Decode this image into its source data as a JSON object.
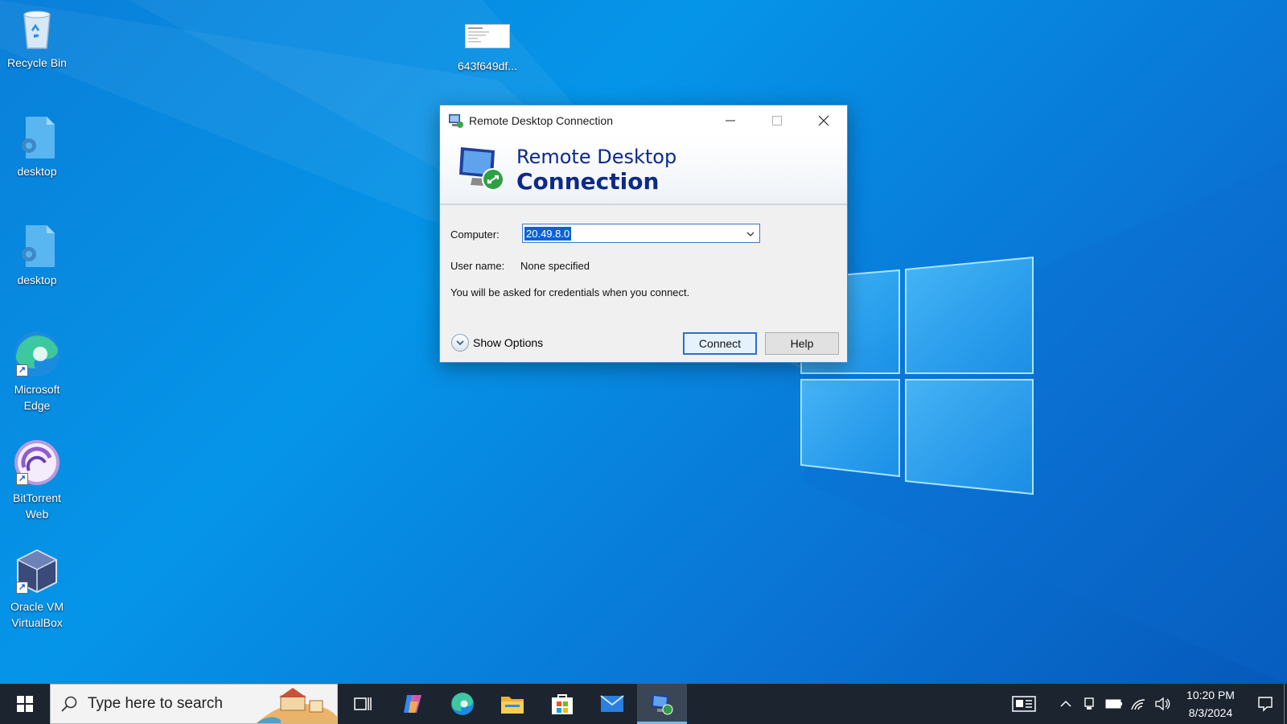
{
  "desktop": {
    "icons": [
      {
        "label": "Recycle Bin",
        "icon": "recycle-bin-icon"
      },
      {
        "label": "643f649df...",
        "icon": "image-thumbnail-icon"
      },
      {
        "label": "desktop",
        "icon": "settings-file-icon"
      },
      {
        "label": "desktop",
        "icon": "settings-file-icon"
      },
      {
        "label": "Microsoft Edge",
        "icon": "edge-icon"
      },
      {
        "label": "BitTorrent Web",
        "icon": "bittorrent-icon"
      },
      {
        "label": "Oracle VM VirtualBox",
        "icon": "virtualbox-icon"
      }
    ]
  },
  "rdp_dialog": {
    "title": "Remote Desktop Connection",
    "banner_line1": "Remote Desktop",
    "banner_line2": "Connection",
    "computer_label": "Computer:",
    "computer_value": "20.49.8.0",
    "username_label": "User name:",
    "username_value": "None specified",
    "info_text": "You will be asked for credentials when you connect.",
    "show_options_label": "Show Options",
    "connect_label": "Connect",
    "help_label": "Help"
  },
  "taskbar": {
    "search_placeholder": "Type here to search",
    "pinned": [
      "task-view-icon",
      "copilot-icon",
      "edge-icon",
      "file-explorer-icon",
      "microsoft-store-icon",
      "mail-icon",
      "remote-desktop-icon"
    ],
    "active_app": "remote-desktop-icon",
    "time": "10:20 PM",
    "date": "8/3/2024"
  },
  "colors": {
    "desktop_blue": "#0a7fd9",
    "taskbar_bg": "#1c2430",
    "banner_text": "#0d2a87",
    "selection": "#0b62d5"
  }
}
